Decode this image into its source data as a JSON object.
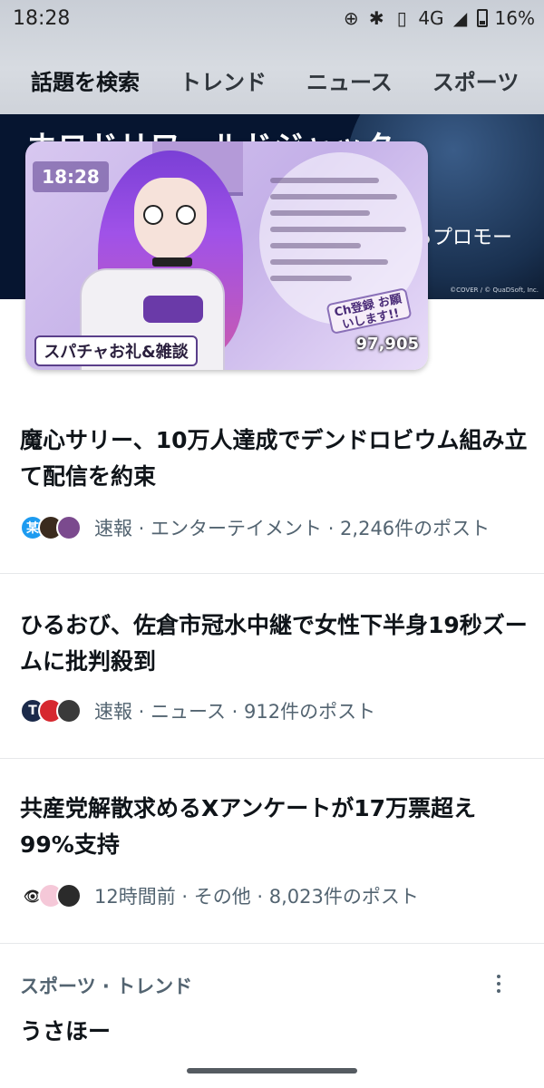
{
  "status_bar": {
    "time": "18:28",
    "network": "4G",
    "battery": "16%",
    "icons": [
      "hotspot-icon",
      "bluetooth-icon",
      "vibrate-icon",
      "signal-icon",
      "battery-icon"
    ]
  },
  "tabs": [
    {
      "label": "話題を検索"
    },
    {
      "label": "トレンド"
    },
    {
      "label": "ニュース"
    },
    {
      "label": "スポーツ"
    }
  ],
  "hero": {
    "title": "ホロドリワールドジャック",
    "promo": "るプロモー",
    "copyright": "©COVER / © QuaDSoft, Inc."
  },
  "pip_video": {
    "caption": "スパチャお礼&雑談",
    "count": "97,905",
    "sub_badge": "Ch登録 お願いします!!",
    "time_stamp": "18:28"
  },
  "trends": [
    {
      "title": "魔心サリー、10万人達成でデンドロビウム組み立て配信を約束",
      "meta": "速報 · エンターテイメント · 2,246件のポスト",
      "avatar_colors": [
        "#1d9bf0",
        "#3b2b1e",
        "#7b4a8e"
      ],
      "avatar_text": [
        "某",
        "",
        ""
      ]
    },
    {
      "title": "ひるおび、佐倉市冠水中継で女性下半身19秒ズームに批判殺到",
      "meta": "速報 · ニュース · 912件のポスト",
      "avatar_colors": [
        "#1b2a4a",
        "#d6282f",
        "#3a3a3a"
      ],
      "avatar_text": [
        "T",
        "",
        ""
      ]
    },
    {
      "title": "共産党解散求めるXアンケートが17万票超え99%支持",
      "meta": "12時間前 · その他 · 8,023件のポスト",
      "avatar_colors": [
        "#ffffff",
        "#f5c8d8",
        "#2b2b2b"
      ],
      "avatar_text": [
        "👁",
        "",
        ""
      ]
    }
  ],
  "sports_section": {
    "label": "スポーツ · トレンド",
    "trend": "うさほー"
  }
}
